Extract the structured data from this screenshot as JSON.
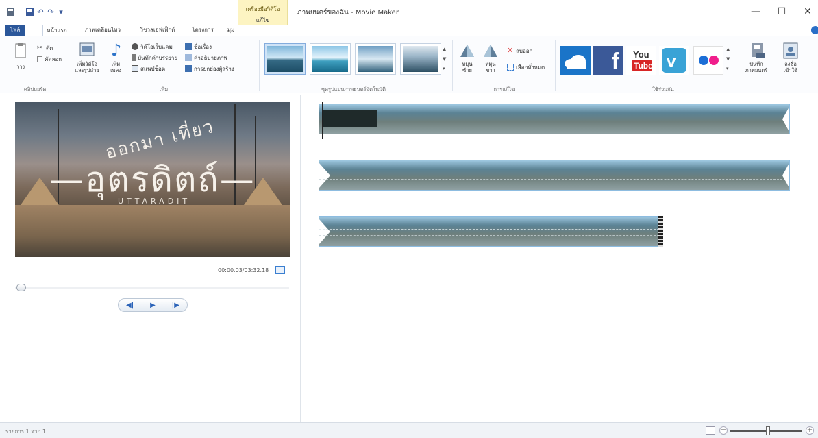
{
  "window": {
    "title": "ภาพยนตร์ของฉัน - Movie Maker",
    "context_tab_label": "เครื่องมือวิดีโอ",
    "context_tab_sub": "แก้ไข",
    "minimize": "—",
    "maximize": "☐",
    "close": "✕"
  },
  "tabs": [
    "ไฟล์",
    "หน้าแรก",
    "ภาพเคลื่อนไหว",
    "วิชวลเอฟเฟ็กต์",
    "โครงการ",
    "มุมมอง"
  ],
  "ribbon": {
    "clipboard": {
      "paste": "วาง",
      "cut": "ตัด",
      "copy": "คัดลอก",
      "group": "คลิปบอร์ด"
    },
    "add": {
      "add_videos": "เพิ่มวิดีโอ\nและรูปถ่าย",
      "add_music": "เพิ่ม\nเพลง",
      "webcam": "วิดีโอเว็บแคม",
      "narration": "บันทึกคำบรรยาย",
      "snapshot": "สแนปช็อต",
      "title": "ชื่อเรื่อง",
      "caption": "คำอธิบายภาพ",
      "credits": "การยกย่องผู้สร้าง",
      "group": "เพิ่ม"
    },
    "themes": {
      "group": "ชุดรูปแบบภาพยนตร์อัตโนมัติ"
    },
    "editing": {
      "rotate_left": "หมุน\nซ้าย",
      "rotate_right": "หมุน\nขวา",
      "remove": "ลบออก",
      "select_all": "เลือกทั้งหมด",
      "group": "การแก้ไข"
    },
    "share": {
      "save_movie": "บันทึก\nภาพยนตร์",
      "sign_in": "ลงชื่อ\nเข้าใช้",
      "group": "ใช้ร่วมกัน"
    }
  },
  "preview": {
    "overlay_top": "ออกมา เที่ยว",
    "overlay_main": "—อุตรดิตถ์—",
    "overlay_sub": "UTTARADIT",
    "timecode": "00:00.03/03:32.18"
  },
  "transport": {
    "prev": "◀|",
    "play": "▶",
    "next": "|▶"
  },
  "status": {
    "text": "รายการ 1 จาก 1"
  },
  "zoom": {
    "minus": "−",
    "plus": "+",
    "level": 0.5
  }
}
